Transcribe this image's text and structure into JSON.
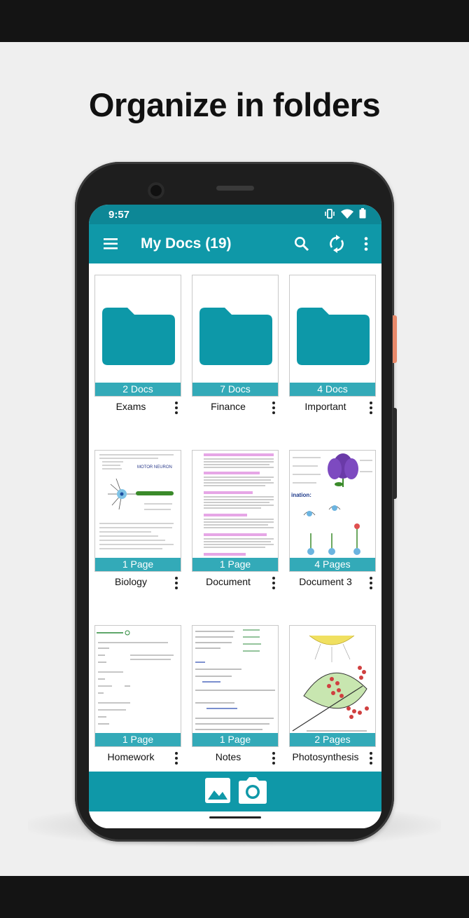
{
  "headline": "Organize in folders",
  "status": {
    "time": "9:57"
  },
  "appbar": {
    "title": "My Docs (19)",
    "menu_icon": "hamburger-menu-icon",
    "actions": [
      "search-icon",
      "sync-icon",
      "more-vertical-icon"
    ]
  },
  "items": [
    {
      "name": "Exams",
      "count": "2 Docs",
      "kind": "folder"
    },
    {
      "name": "Finance",
      "count": "7 Docs",
      "kind": "folder"
    },
    {
      "name": "Important",
      "count": "4 Docs",
      "kind": "folder"
    },
    {
      "name": "Biology",
      "count": "1 Page",
      "kind": "document"
    },
    {
      "name": "Document",
      "count": "1 Page",
      "kind": "document"
    },
    {
      "name": "Document 3",
      "count": "4 Pages",
      "kind": "document"
    },
    {
      "name": "Homework",
      "count": "1 Page",
      "kind": "document"
    },
    {
      "name": "Notes",
      "count": "1 Page",
      "kind": "document"
    },
    {
      "name": "Photosynthesis",
      "count": "2 Pages",
      "kind": "document"
    }
  ],
  "thumb_text": {
    "biology_title": "MOTOR NEURON",
    "document3_heading": "ination:"
  },
  "bottom": {
    "gallery_icon": "gallery-icon",
    "camera_icon": "camera-icon"
  },
  "colors": {
    "primary": "#0f98a8",
    "status": "#0d8796",
    "label": "#33aab8",
    "folder": "#0d98a8"
  }
}
